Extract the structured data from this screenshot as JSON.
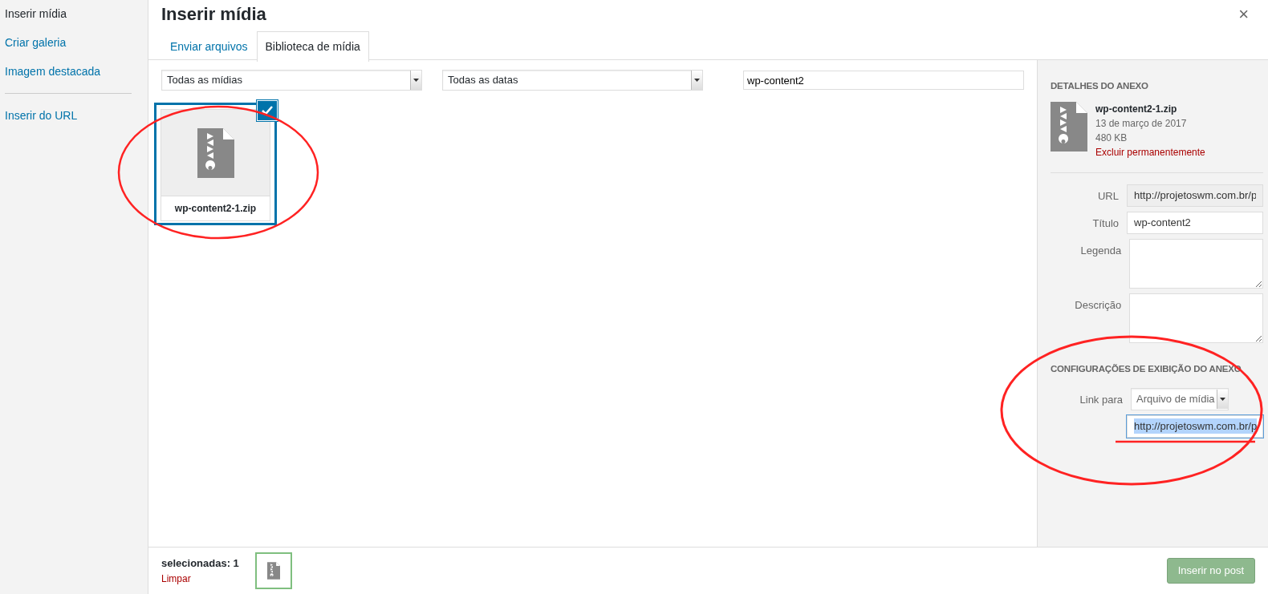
{
  "sidebar": {
    "groups": [
      [
        {
          "label": "Inserir mídia",
          "selected": true
        },
        {
          "label": "Criar galeria",
          "selected": false
        },
        {
          "label": "Imagem destacada",
          "selected": false
        }
      ],
      [
        {
          "label": "Inserir do URL",
          "selected": false
        }
      ]
    ]
  },
  "title": "Inserir mídia",
  "close": "×",
  "tabs": [
    {
      "label": "Enviar arquivos",
      "selected": false
    },
    {
      "label": "Biblioteca de mídia",
      "selected": true
    }
  ],
  "filters": {
    "media_type": "Todas as mídias",
    "date": "Todas as datas",
    "search": "wp-content2"
  },
  "attachments": [
    {
      "filename": "wp-content2-1.zip",
      "selected": true
    }
  ],
  "details": {
    "heading": "DETALHES DO ANEXO",
    "filename": "wp-content2-1.zip",
    "date": "13 de março de 2017",
    "size": "480 KB",
    "delete_link": "Excluir permanentemente",
    "fields": [
      {
        "label": "URL",
        "kind": "readonly",
        "value": "http://projetoswm.com.br/p"
      },
      {
        "label": "Título",
        "kind": "input",
        "value": "wp-content2"
      },
      {
        "label": "Legenda",
        "kind": "textarea"
      },
      {
        "label": "Descrição",
        "kind": "textarea"
      }
    ]
  },
  "display_settings": {
    "heading": "CONFIGURAÇÕES DE EXIBIÇÃO DO ANEXO",
    "link_label": "Link para",
    "link_value": "Arquivo de mídia",
    "url_value": "http://projetoswm.com.br/p",
    "url_text_selected": true
  },
  "toolbar": {
    "selection_count": "selecionadas: 1",
    "clear": "Limpar",
    "insert_button": {
      "label": "Inserir no post",
      "disabled": true
    }
  }
}
